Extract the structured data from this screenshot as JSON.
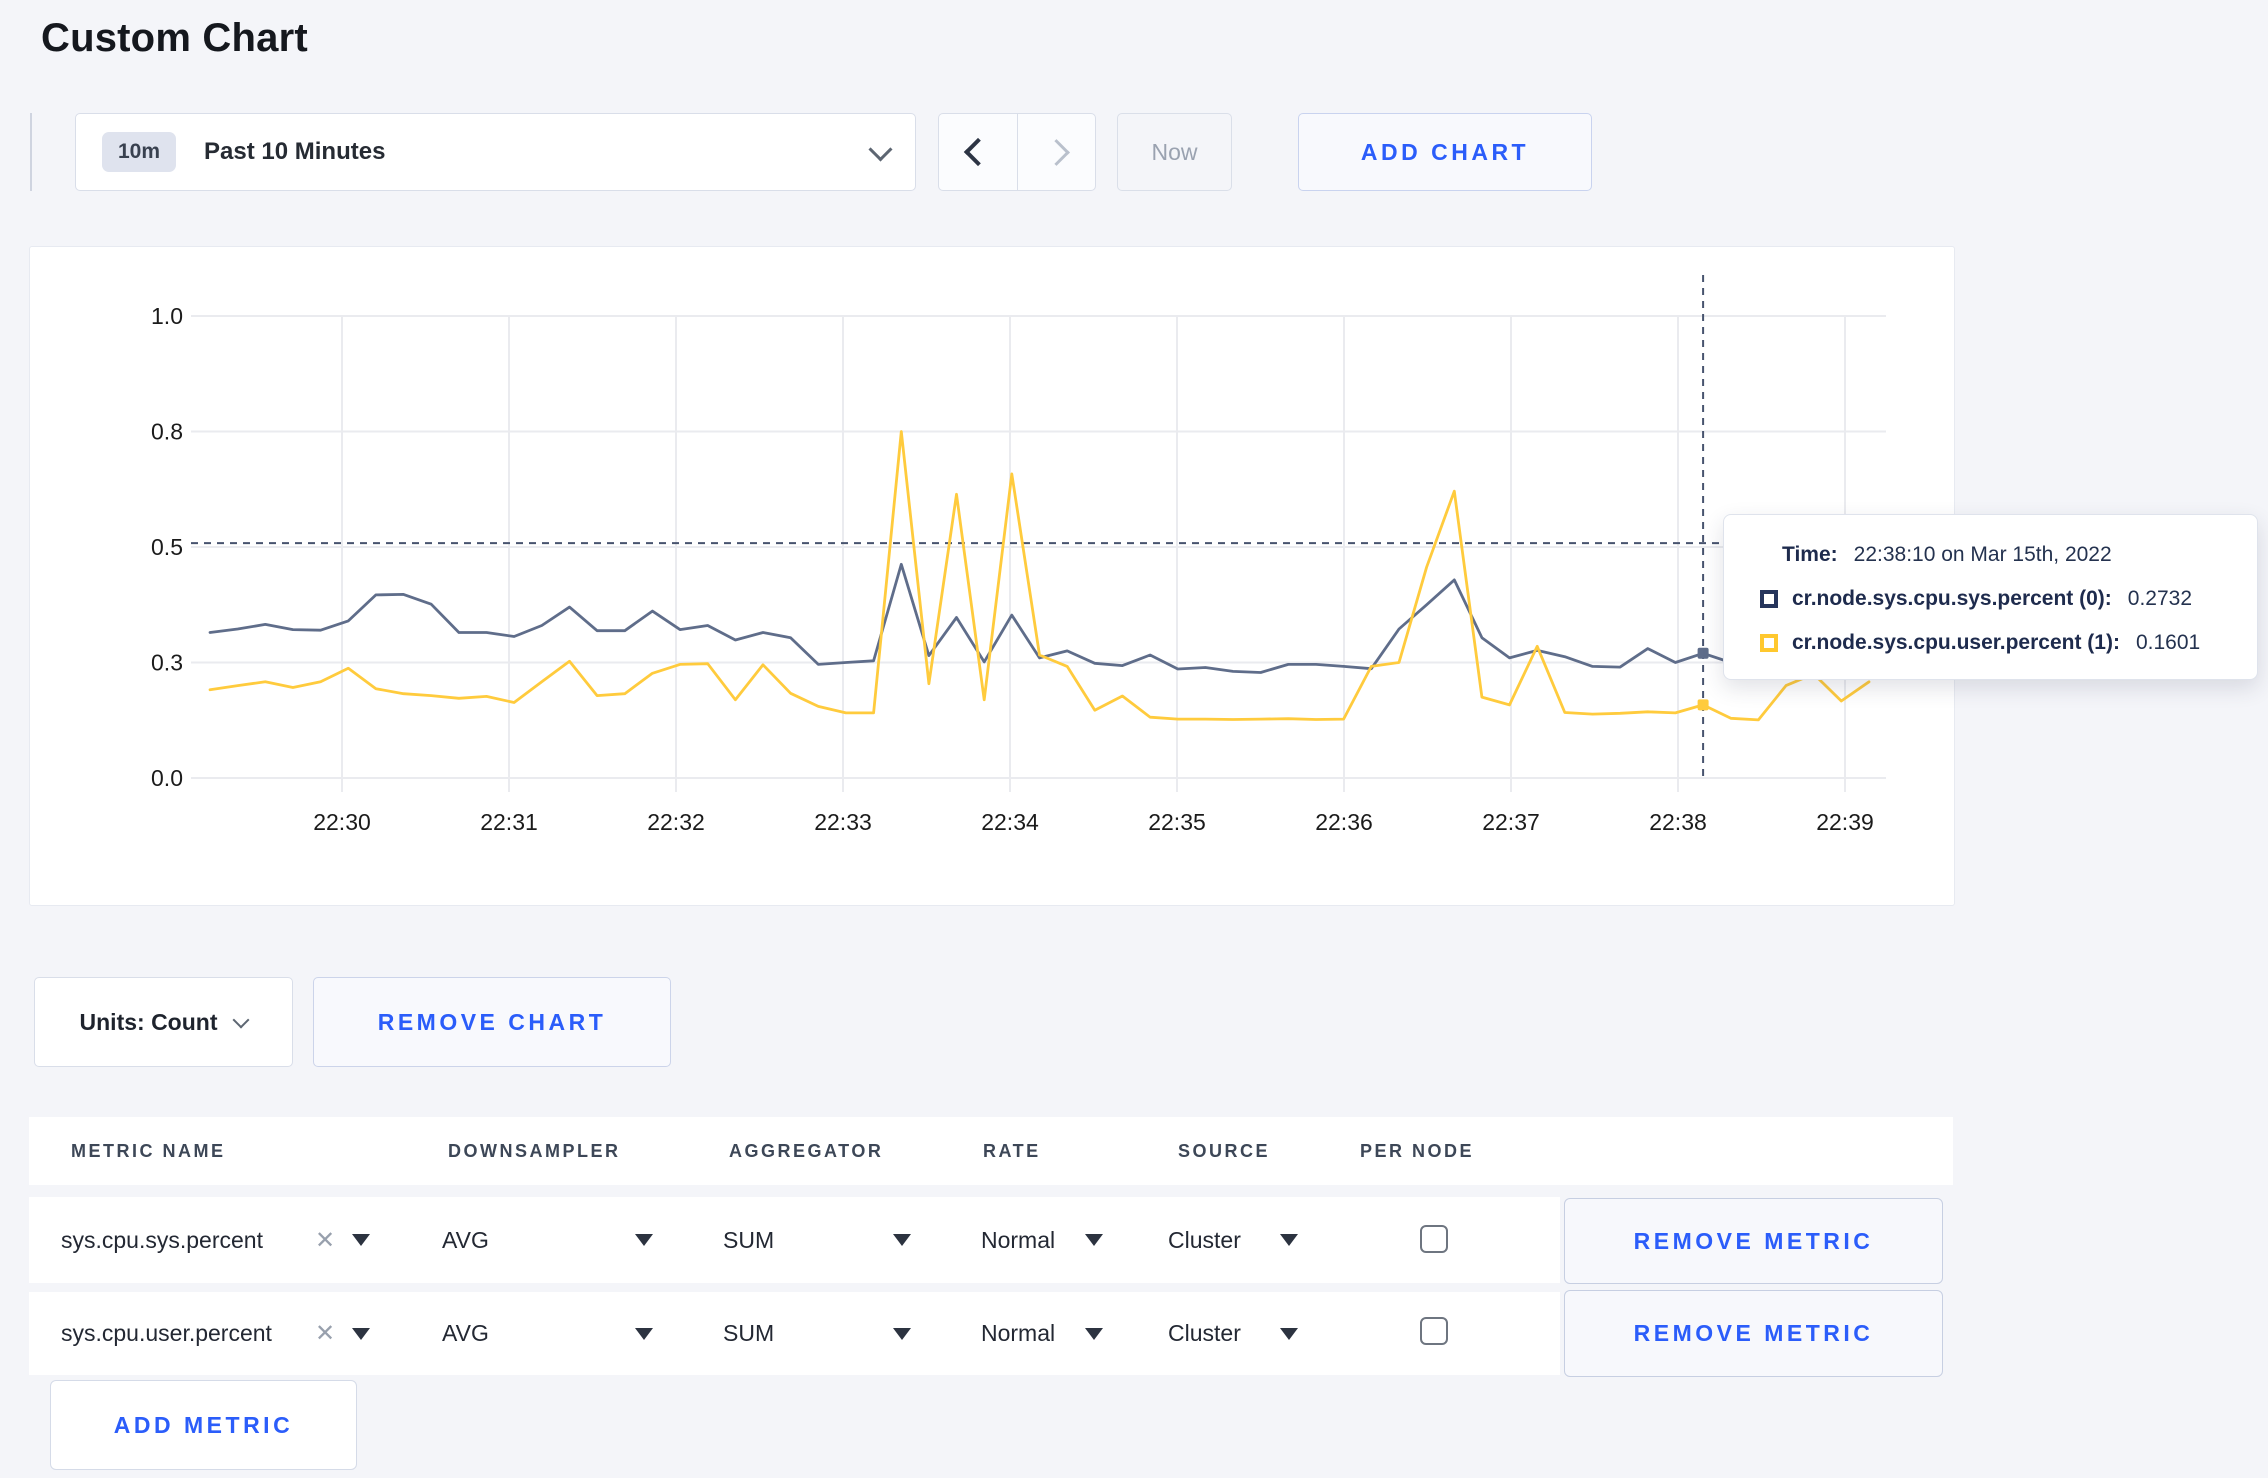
{
  "page": {
    "title": "Custom Chart"
  },
  "toolbar": {
    "range_badge": "10m",
    "range_label": "Past 10 Minutes",
    "now_label": "Now",
    "add_chart_label": "ADD CHART"
  },
  "chart_data": {
    "type": "line",
    "title": "",
    "xlabel": "",
    "ylabel": "",
    "grid": true,
    "legend_position": "none",
    "y_tick_labels": [
      "0.0",
      "0.3",
      "0.5",
      "0.8",
      "1.0"
    ],
    "y_tick_values": [
      0,
      0.3,
      0.5,
      0.8,
      1.0
    ],
    "x_tick_labels": [
      "22:30",
      "22:31",
      "22:32",
      "22:33",
      "22:34",
      "22:35",
      "22:36",
      "22:37",
      "22:38",
      "22:39"
    ],
    "x_start_time": "22:29:10",
    "x_interval_seconds": 10,
    "series": [
      {
        "name": "cr.node.sys.cpu.sys.percent (0)",
        "color": "#5f6d8a",
        "values": [
          0.352,
          0.358,
          0.366,
          0.357,
          0.356,
          0.372,
          0.417,
          0.418,
          0.401,
          0.352,
          0.352,
          0.345,
          0.364,
          0.396,
          0.355,
          0.355,
          0.389,
          0.357,
          0.364,
          0.339,
          0.352,
          0.343,
          0.295,
          0.3,
          0.303,
          0.47,
          0.312,
          0.378,
          0.301,
          0.382,
          0.308,
          0.32,
          0.298,
          0.292,
          0.313,
          0.283,
          0.287,
          0.277,
          0.274,
          0.295,
          0.295,
          0.29,
          0.284,
          0.358,
          0.4,
          0.443,
          0.343,
          0.308,
          0.321,
          0.31,
          0.29,
          0.288,
          0.324,
          0.3,
          0.316,
          0.3,
          0.3,
          0.305,
          0.298,
          0.308,
          0.303
        ]
      },
      {
        "name": "cr.node.sys.cpu.user.percent (1)",
        "color": "#ffcb3d",
        "values": [
          0.229,
          0.24,
          0.25,
          0.235,
          0.25,
          0.285,
          0.232,
          0.219,
          0.214,
          0.207,
          0.212,
          0.196,
          0.25,
          0.302,
          0.214,
          0.219,
          0.272,
          0.295,
          0.297,
          0.203,
          0.294,
          0.22,
          0.186,
          0.169,
          0.169,
          0.8,
          0.245,
          0.637,
          0.203,
          0.69,
          0.313,
          0.29,
          0.176,
          0.213,
          0.158,
          0.153,
          0.153,
          0.152,
          0.153,
          0.154,
          0.152,
          0.153,
          0.29,
          0.3,
          0.465,
          0.645,
          0.21,
          0.19,
          0.328,
          0.17,
          0.166,
          0.168,
          0.172,
          0.169,
          0.19,
          0.155,
          0.151,
          0.24,
          0.27,
          0.2,
          0.25
        ]
      }
    ],
    "crosshair": {
      "index": 54,
      "y_value": 0.51,
      "time": "22:38:10"
    }
  },
  "tooltip": {
    "time_label": "Time:",
    "time_value": "22:38:10 on Mar 15th, 2022",
    "rows": [
      {
        "label": "cr.node.sys.cpu.sys.percent (0):",
        "value": "0.2732",
        "swatch_color": "#26355c"
      },
      {
        "label": "cr.node.sys.cpu.user.percent (1):",
        "value": "0.1601",
        "swatch_color": "#ffc82e"
      }
    ]
  },
  "chart_footer": {
    "units_label": "Units: Count",
    "remove_chart_label": "REMOVE CHART"
  },
  "metrics_table": {
    "headers": [
      "METRIC NAME",
      "DOWNSAMPLER",
      "AGGREGATOR",
      "RATE",
      "SOURCE",
      "PER NODE"
    ],
    "rows": [
      {
        "metric": "sys.cpu.sys.percent",
        "downsampler": "AVG",
        "aggregator": "SUM",
        "rate": "Normal",
        "source": "Cluster",
        "per_node_checked": false,
        "remove_label": "REMOVE METRIC"
      },
      {
        "metric": "sys.cpu.user.percent",
        "downsampler": "AVG",
        "aggregator": "SUM",
        "rate": "Normal",
        "source": "Cluster",
        "per_node_checked": false,
        "remove_label": "REMOVE METRIC"
      }
    ],
    "add_metric_label": "ADD METRIC"
  },
  "colors": {
    "accent_blue": "#2b5dfa",
    "page_background": "#f4f5f9",
    "series_sys": "#5f6d8a",
    "series_user": "#ffcb3d"
  }
}
